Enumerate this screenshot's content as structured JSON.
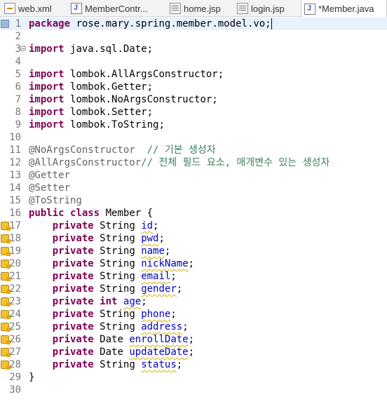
{
  "tabs": [
    {
      "label": "web.xml",
      "icon": "xml-file-icon",
      "active": false
    },
    {
      "label": "MemberContr...",
      "icon": "java-file-icon",
      "active": false
    },
    {
      "label": "home.jsp",
      "icon": "jsp-file-icon",
      "active": false
    },
    {
      "label": "login.jsp",
      "icon": "jsp-file-icon",
      "active": false
    },
    {
      "label": "*Member.java",
      "icon": "java-file-icon",
      "active": true
    }
  ],
  "code_lines": [
    {
      "num": "1",
      "marker": "bookmark",
      "tokens": [
        [
          "kw",
          "package"
        ],
        [
          "",
          "rose.mary.spring.member.model.vo;"
        ]
      ]
    },
    {
      "num": "2",
      "tokens": []
    },
    {
      "num": "3",
      "fold": true,
      "tokens": [
        [
          "kw",
          "import"
        ],
        [
          "",
          "java.sql.Date;"
        ]
      ]
    },
    {
      "num": "4",
      "tokens": []
    },
    {
      "num": "5",
      "tokens": [
        [
          "kw",
          "import"
        ],
        [
          "",
          "lombok.AllArgsConstructor;"
        ]
      ]
    },
    {
      "num": "6",
      "tokens": [
        [
          "kw",
          "import"
        ],
        [
          "",
          "lombok.Getter;"
        ]
      ]
    },
    {
      "num": "7",
      "tokens": [
        [
          "kw",
          "import"
        ],
        [
          "",
          "lombok.NoArgsConstructor;"
        ]
      ]
    },
    {
      "num": "8",
      "tokens": [
        [
          "kw",
          "import"
        ],
        [
          "",
          "lombok.Setter;"
        ]
      ]
    },
    {
      "num": "9",
      "tokens": [
        [
          "kw",
          "import"
        ],
        [
          "",
          "lombok.ToString;"
        ]
      ]
    },
    {
      "num": "10",
      "tokens": []
    },
    {
      "num": "11",
      "tokens": [
        [
          "ann",
          "@NoArgsConstructor"
        ],
        [
          "",
          "  "
        ],
        [
          "cm",
          "// 기본 생성자"
        ]
      ]
    },
    {
      "num": "12",
      "tokens": [
        [
          "ann",
          "@AllArgsConstructor"
        ],
        [
          "",
          ""
        ],
        [
          "cm",
          "// 전체 필드 요소, 매개변수 있는 생성자"
        ]
      ]
    },
    {
      "num": "13",
      "tokens": [
        [
          "ann",
          "@Getter"
        ]
      ]
    },
    {
      "num": "14",
      "tokens": [
        [
          "ann",
          "@Setter"
        ]
      ]
    },
    {
      "num": "15",
      "tokens": [
        [
          "ann",
          "@ToString"
        ]
      ]
    },
    {
      "num": "16",
      "tokens": [
        [
          "kw",
          "public"
        ],
        [
          "kw",
          "class"
        ],
        [
          "",
          "Member {"
        ]
      ]
    },
    {
      "num": "17",
      "marker": "warn",
      "tokens": [
        [
          "",
          "    "
        ],
        [
          "kw",
          "private"
        ],
        [
          "",
          "String"
        ],
        [
          "fld",
          "id"
        ],
        [
          "",
          ";"
        ]
      ]
    },
    {
      "num": "18",
      "marker": "warn",
      "tokens": [
        [
          "",
          "    "
        ],
        [
          "kw",
          "private"
        ],
        [
          "",
          "String"
        ],
        [
          "fld",
          "pwd"
        ],
        [
          "",
          ";"
        ]
      ]
    },
    {
      "num": "19",
      "marker": "warn",
      "tokens": [
        [
          "",
          "    "
        ],
        [
          "kw",
          "private"
        ],
        [
          "",
          "String"
        ],
        [
          "fld",
          "name"
        ],
        [
          "",
          ";"
        ]
      ]
    },
    {
      "num": "20",
      "marker": "warn",
      "tokens": [
        [
          "",
          "    "
        ],
        [
          "kw",
          "private"
        ],
        [
          "",
          "String"
        ],
        [
          "fld",
          "nickName"
        ],
        [
          "",
          ";"
        ]
      ]
    },
    {
      "num": "21",
      "marker": "warn",
      "tokens": [
        [
          "",
          "    "
        ],
        [
          "kw",
          "private"
        ],
        [
          "",
          "String"
        ],
        [
          "fld",
          "email"
        ],
        [
          "",
          ";"
        ]
      ]
    },
    {
      "num": "22",
      "marker": "warn",
      "tokens": [
        [
          "",
          "    "
        ],
        [
          "kw",
          "private"
        ],
        [
          "",
          "String"
        ],
        [
          "fld",
          "gender"
        ],
        [
          "",
          ";"
        ]
      ]
    },
    {
      "num": "23",
      "marker": "warn",
      "tokens": [
        [
          "",
          "    "
        ],
        [
          "kw",
          "private"
        ],
        [
          "kw",
          "int"
        ],
        [
          "fld",
          "age"
        ],
        [
          "",
          ";"
        ]
      ]
    },
    {
      "num": "24",
      "marker": "warn",
      "tokens": [
        [
          "",
          "    "
        ],
        [
          "kw",
          "private"
        ],
        [
          "",
          "String"
        ],
        [
          "fld",
          "phone"
        ],
        [
          "",
          ";"
        ]
      ]
    },
    {
      "num": "25",
      "marker": "warn",
      "tokens": [
        [
          "",
          "    "
        ],
        [
          "kw",
          "private"
        ],
        [
          "",
          "String"
        ],
        [
          "fld",
          "address"
        ],
        [
          "",
          ";"
        ]
      ]
    },
    {
      "num": "26",
      "marker": "warn",
      "tokens": [
        [
          "",
          "    "
        ],
        [
          "kw",
          "private"
        ],
        [
          "",
          "Date"
        ],
        [
          "fld",
          "enrollDate"
        ],
        [
          "",
          ";"
        ]
      ]
    },
    {
      "num": "27",
      "marker": "warn",
      "tokens": [
        [
          "",
          "    "
        ],
        [
          "kw",
          "private"
        ],
        [
          "",
          "Date"
        ],
        [
          "fld",
          "updateDate"
        ],
        [
          "",
          ";"
        ]
      ]
    },
    {
      "num": "28",
      "marker": "warn",
      "tokens": [
        [
          "",
          "    "
        ],
        [
          "kw",
          "private"
        ],
        [
          "",
          "String"
        ],
        [
          "fld",
          "status"
        ],
        [
          "",
          ";"
        ]
      ]
    },
    {
      "num": "29",
      "tokens": [
        [
          "",
          "}"
        ]
      ]
    },
    {
      "num": "30",
      "tokens": []
    }
  ],
  "colors": {
    "keyword": "#7f0055",
    "annotation": "#646464",
    "comment": "#3f7f5f",
    "field": "#0000c0",
    "line_number": "#787878"
  }
}
